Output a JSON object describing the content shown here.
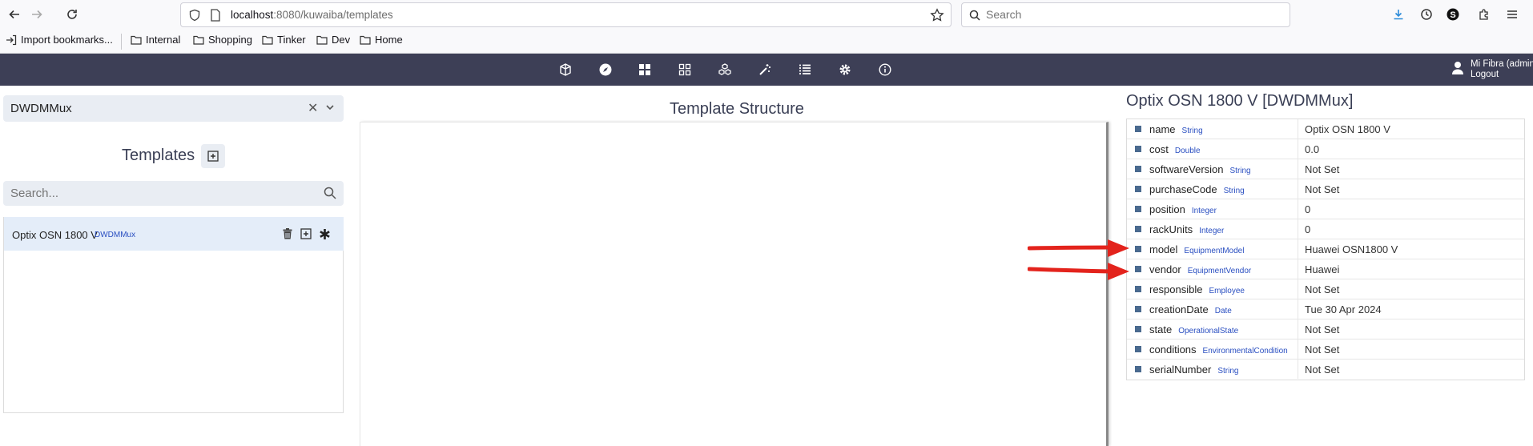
{
  "browser": {
    "url_host": "localhost",
    "url_rest": ":8080/kuwaiba/templates",
    "search_placeholder": "Search",
    "bookmarks": [
      {
        "label": "Import bookmarks...",
        "icon": "import-icon"
      },
      {
        "label": "Internal",
        "icon": "folder-icon"
      },
      {
        "label": "Shopping",
        "icon": "folder-icon"
      },
      {
        "label": "Tinker",
        "icon": "folder-icon"
      },
      {
        "label": "Dev",
        "icon": "folder-icon"
      },
      {
        "label": "Home",
        "icon": "folder-icon"
      }
    ]
  },
  "header": {
    "user_name": "Mi Fibra (admin)",
    "logout_label": "Logout",
    "icons": [
      "cube-icon",
      "compass-icon",
      "grid-icon",
      "grid-outline-icon",
      "cubes-icon",
      "magic-wand-icon",
      "list-icon",
      "gear-icon",
      "info-icon"
    ]
  },
  "left": {
    "class_selector_value": "DWDMMux",
    "templates_title": "Templates",
    "search_placeholder": "Search...",
    "items": [
      {
        "name": "Optix OSN 1800 V",
        "class": "DWDMMux"
      }
    ]
  },
  "center": {
    "title": "Template Structure"
  },
  "right": {
    "title": "Optix OSN 1800 V [DWDMMux]",
    "properties": [
      {
        "name": "name",
        "type": "String",
        "value": "Optix OSN 1800 V"
      },
      {
        "name": "cost",
        "type": "Double",
        "value": "0.0"
      },
      {
        "name": "softwareVersion",
        "type": "String",
        "value": "Not Set"
      },
      {
        "name": "purchaseCode",
        "type": "String",
        "value": "Not Set"
      },
      {
        "name": "position",
        "type": "Integer",
        "value": "0"
      },
      {
        "name": "rackUnits",
        "type": "Integer",
        "value": "0"
      },
      {
        "name": "model",
        "type": "EquipmentModel",
        "value": "Huawei OSN1800 V"
      },
      {
        "name": "vendor",
        "type": "EquipmentVendor",
        "value": "Huawei"
      },
      {
        "name": "responsible",
        "type": "Employee",
        "value": "Not Set"
      },
      {
        "name": "creationDate",
        "type": "Date",
        "value": "Tue 30 Apr 2024"
      },
      {
        "name": "state",
        "type": "OperationalState",
        "value": "Not Set"
      },
      {
        "name": "conditions",
        "type": "EnvironmentalCondition",
        "value": "Not Set"
      },
      {
        "name": "serialNumber",
        "type": "String",
        "value": "Not Set"
      }
    ]
  },
  "colors": {
    "header_bg": "#3d3f56",
    "accent_blue": "#2a4fc1",
    "selected_row": "#e4edf9",
    "annotation_arrow": "#e3231c"
  }
}
